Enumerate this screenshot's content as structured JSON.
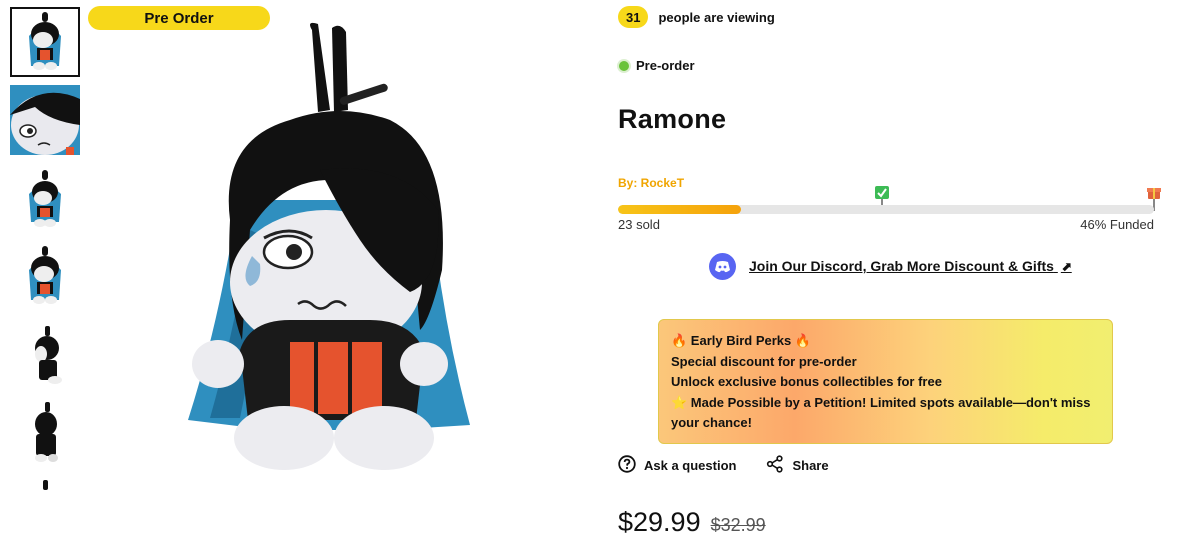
{
  "badge": {
    "label": "Pre Order"
  },
  "viewing": {
    "count": "31",
    "text": "people are viewing"
  },
  "status": {
    "label": "Pre-order",
    "color": "#6ac23b"
  },
  "product": {
    "title": "Ramone",
    "author": "By: RockeT"
  },
  "progress": {
    "funded_fraction": 0.23,
    "sold_text": "23 sold",
    "funded_text": "46% Funded",
    "milestone_icons": [
      "check-flag-icon",
      "gift-icon"
    ]
  },
  "discord": {
    "label": "Join Our Discord, Grab More Discount & Gifts",
    "arrow": "⬈"
  },
  "perks": {
    "line1": "🔥 Early Bird Perks 🔥",
    "line2": "Special discount for pre-order",
    "line3": "Unlock exclusive bonus collectibles for free",
    "line4": "⭐ Made Possible by a Petition! Limited spots available—don't miss",
    "line5": "your chance!"
  },
  "actions": {
    "ask": "Ask a question",
    "share": "Share"
  },
  "price": {
    "current": "$29.99",
    "original": "$32.99"
  },
  "colors": {
    "accent": "#f7d81a",
    "author": "#f0a500",
    "discord": "#5865f2"
  }
}
